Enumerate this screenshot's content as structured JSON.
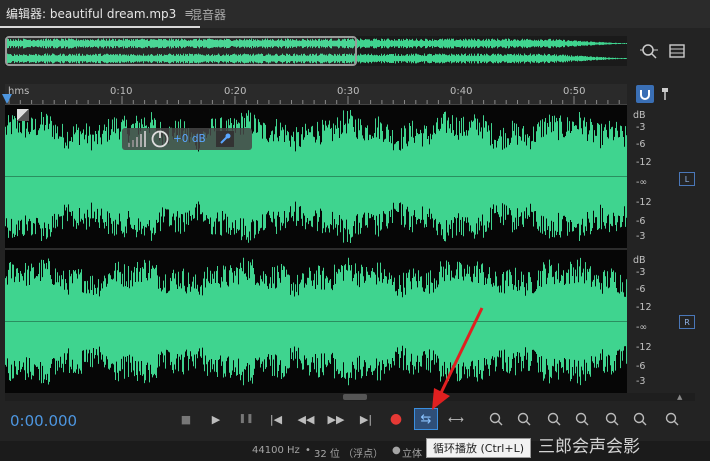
{
  "tabs": {
    "editor_label": "编辑器: beautiful dream.mp3",
    "editor_menu_icon": "≡",
    "mixer_label": "混音器"
  },
  "ruler": {
    "unit": "hms",
    "ticks": [
      "0:10",
      "0:20",
      "0:30",
      "0:40",
      "0:50"
    ]
  },
  "hud": {
    "gain_value": "+0 dB"
  },
  "channels": {
    "left": {
      "badge": "L",
      "scale": [
        "dB",
        "-3",
        "-6",
        "-12",
        "-∞",
        "-12",
        "-6",
        "-3"
      ]
    },
    "right": {
      "badge": "R",
      "scale": [
        "dB",
        "-3",
        "-6",
        "-12",
        "-∞",
        "-12",
        "-6",
        "-3"
      ]
    }
  },
  "transport": {
    "timecode": "0:00.000",
    "buttons": [
      "stop-icon",
      "play-icon",
      "pause-icon",
      "go-to-start-icon",
      "rewind-icon",
      "fast-forward-icon",
      "go-to-end-icon",
      "record-icon",
      "loop-playback-icon",
      "skip-selection-icon"
    ],
    "zoom_buttons": [
      "zoom-in-amplitude-icon",
      "zoom-out-amplitude-icon",
      "zoom-in-time-icon",
      "zoom-out-time-icon",
      "zoom-full-icon",
      "zoom-in-left-icon",
      "zoom-in-right-icon"
    ]
  },
  "status": {
    "sample_rate": "44100 Hz",
    "bit_depth": "32 位 （浮点）",
    "channels": "立体",
    "tooltip": "循环播放 (Ctrl+L)"
  },
  "watermark": "三郎会声会影",
  "colors": {
    "waveform": "#3fd48f",
    "timecode": "#4d96e0",
    "record": "#e53935",
    "loop_active": "#3a8fe0",
    "arrow": "#e02020"
  }
}
